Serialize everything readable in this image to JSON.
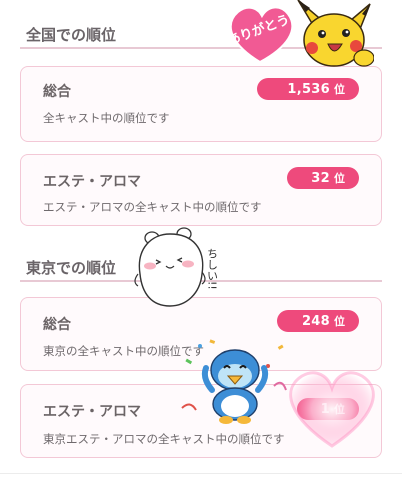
{
  "sections": [
    {
      "title": "全国での順位",
      "cards": [
        {
          "title": "総合",
          "rank": "1,536",
          "unit": "位",
          "desc": "全キャスト中の順位です"
        },
        {
          "title": "エステ・アロマ",
          "rank": "32",
          "unit": "位",
          "desc": "エステ・アロマの全キャスト中の順位です"
        }
      ]
    },
    {
      "title": "東京での順位",
      "cards": [
        {
          "title": "総合",
          "rank": "248",
          "unit": "位",
          "desc": "東京の全キャスト中の順位です"
        },
        {
          "title": "エステ・アロマ",
          "rank": "1",
          "unit": "位",
          "desc": "東京エステ・アロマの全キャスト中の順位です"
        }
      ]
    }
  ],
  "stickers": {
    "thanks_text": "ありがとう",
    "chiikawa_text": "ちしい!!"
  },
  "colors": {
    "accent": "#ee4a7c",
    "card_border": "#f3c8d6",
    "rule": "#e8c9d4"
  }
}
